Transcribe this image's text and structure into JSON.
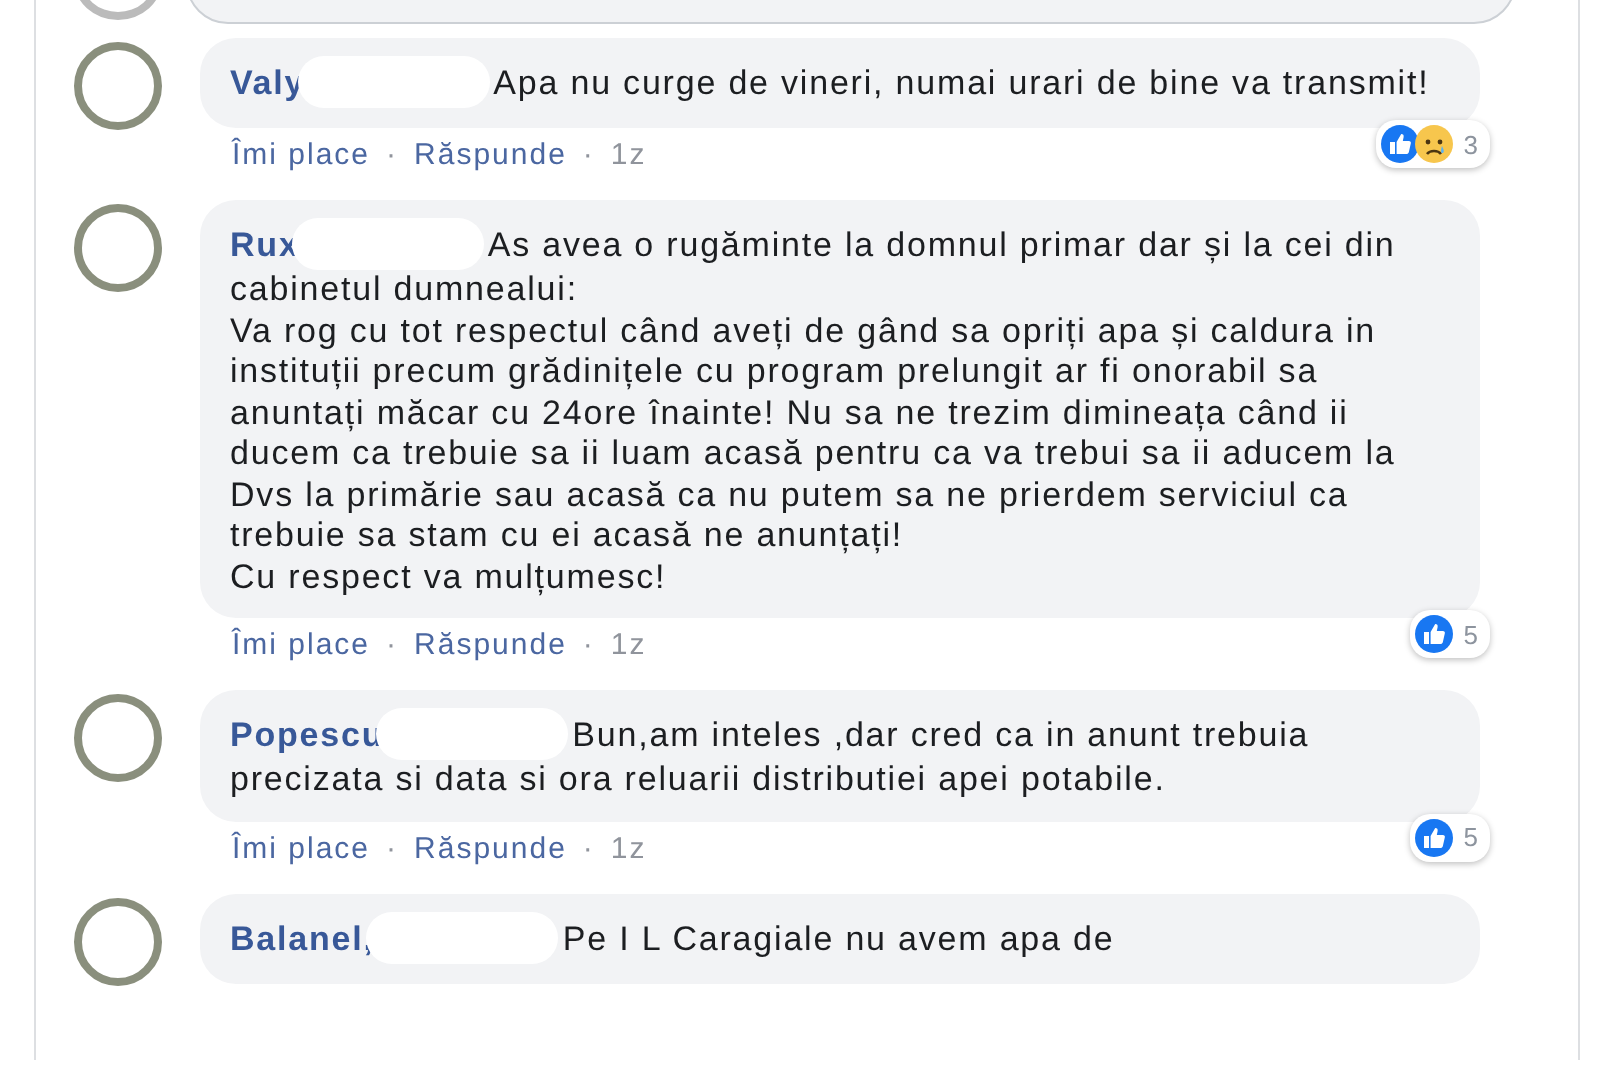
{
  "comments": [
    {
      "name": "Valy",
      "text": "Apa nu curge de vineri, numai urari de bine va transmit!",
      "redacted": true,
      "reactions": [
        {
          "kind": "like"
        },
        {
          "kind": "sad"
        }
      ],
      "reaction_count": "3",
      "actions": {
        "like": "Îmi place",
        "separator": "·",
        "reply": "Răspunde",
        "time": "1z"
      }
    },
    {
      "name": "Rux",
      "text": "As avea o rugăminte la domnul primar dar și la cei din cabinetul dumnealui:\nVa rog cu tot respectul când aveți de gând sa opriți apa și caldura in instituții precum grădinițele cu program prelungit ar fi onorabil sa anuntați măcar cu 24ore înainte! Nu sa ne trezim dimineața când ii ducem ca trebuie sa ii luam acasă pentru ca va trebui sa ii aducem la Dvs la primărie sau acasă ca nu putem sa ne prierdem serviciul ca trebuie sa stam cu ei acasă ne anunțați!\nCu respect va mulțumesc!",
      "redacted": true,
      "reactions": [
        {
          "kind": "like"
        }
      ],
      "reaction_count": "5",
      "actions": {
        "like": "Îmi place",
        "separator": "·",
        "reply": "Răspunde",
        "time": "1z"
      }
    },
    {
      "name": "Popescu",
      "text": "Bun,am inteles ,dar cred ca in anunt trebuia precizata si data si ora reluarii distributiei apei potabile.",
      "redacted": true,
      "reactions": [
        {
          "kind": "like"
        }
      ],
      "reaction_count": "5",
      "actions": {
        "like": "Îmi place",
        "separator": "·",
        "reply": "Răspunde",
        "time": "1z"
      }
    },
    {
      "name": "Balanel,",
      "text": "Pe I L Caragiale nu avem apa de",
      "redacted": true
    }
  ]
}
